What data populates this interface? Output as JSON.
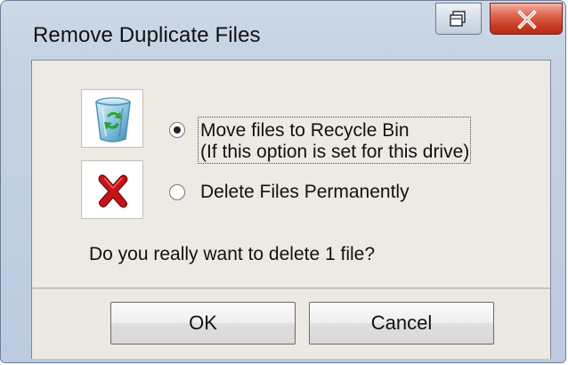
{
  "window": {
    "title": "Remove Duplicate Files",
    "controls": {
      "restore_icon": "restore-icon",
      "close_icon": "close-icon"
    }
  },
  "options": {
    "recycle": {
      "line1": "Move files to Recycle Bin",
      "line2": "(If this option is set for this drive)",
      "selected": true,
      "icon": "recycle-bin-icon"
    },
    "delete": {
      "label": "Delete Files Permanently",
      "selected": false,
      "icon": "delete-x-icon"
    }
  },
  "message": {
    "text": "Do you really want to delete 1 file?"
  },
  "buttons": {
    "ok": "OK",
    "cancel": "Cancel"
  },
  "colors": {
    "window_frame": "#bccbe0",
    "close_button": "#c63a20",
    "dialog_background": "#edeae3"
  }
}
